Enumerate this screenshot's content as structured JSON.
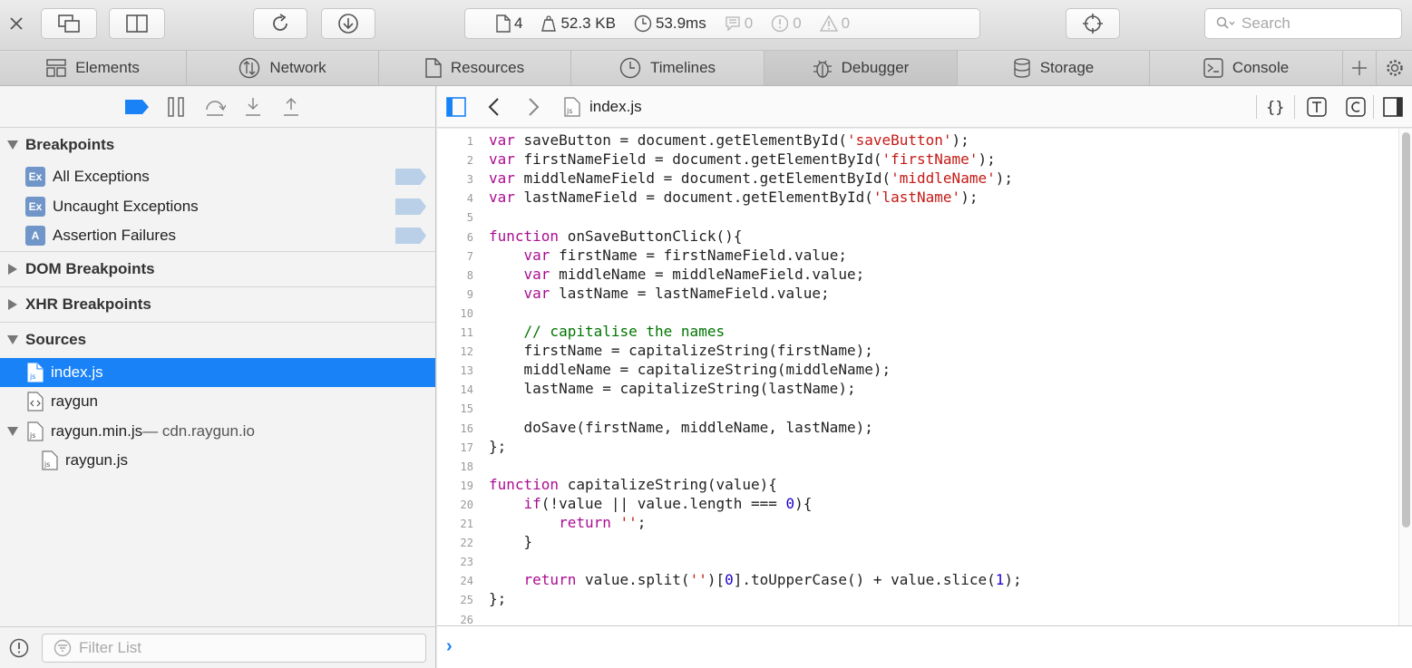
{
  "toolbar": {
    "stats": {
      "resources": "4",
      "size": "52.3 KB",
      "time": "53.9ms",
      "logs": "0",
      "errors": "0",
      "warnings": "0"
    },
    "search_placeholder": "Search",
    "icons": [
      "close-icon",
      "detach-window-icon",
      "split-panel-icon",
      "reload-icon",
      "download-icon",
      "document-icon",
      "weight-icon",
      "clock-icon",
      "log-icon",
      "error-icon",
      "warning-icon",
      "inspect-icon",
      "search-icon"
    ]
  },
  "tabs": [
    {
      "label": "Elements",
      "icon": "elements-icon"
    },
    {
      "label": "Network",
      "icon": "network-icon"
    },
    {
      "label": "Resources",
      "icon": "resources-icon"
    },
    {
      "label": "Timelines",
      "icon": "timelines-icon"
    },
    {
      "label": "Debugger",
      "icon": "debugger-icon",
      "active": true
    },
    {
      "label": "Storage",
      "icon": "storage-icon"
    },
    {
      "label": "Console",
      "icon": "console-icon"
    }
  ],
  "sidebar": {
    "breakpoints": {
      "title": "Breakpoints",
      "items": [
        {
          "badge": "Ex",
          "label": "All Exceptions"
        },
        {
          "badge": "Ex",
          "label": "Uncaught Exceptions"
        },
        {
          "badge": "A",
          "label": "Assertion Failures"
        }
      ]
    },
    "dom_breakpoints": "DOM Breakpoints",
    "xhr_breakpoints": "XHR Breakpoints",
    "sources": {
      "title": "Sources",
      "items": [
        {
          "label": "index.js",
          "selected": true
        },
        {
          "label": "raygun"
        },
        {
          "label": "raygun.min.js",
          "host": " — cdn.raygun.io"
        },
        {
          "label": "raygun.js"
        }
      ]
    },
    "filter_placeholder": "Filter List"
  },
  "editor": {
    "file_name": "index.js",
    "lines": [
      {
        "n": "1",
        "t": "var saveButton = document.getElementById('saveButton');"
      },
      {
        "n": "2",
        "t": "var firstNameField = document.getElementById('firstName');"
      },
      {
        "n": "3",
        "t": "var middleNameField = document.getElementById('middleName');"
      },
      {
        "n": "4",
        "t": "var lastNameField = document.getElementById('lastName');"
      },
      {
        "n": "5",
        "t": ""
      },
      {
        "n": "6",
        "t": "function onSaveButtonClick(){"
      },
      {
        "n": "7",
        "t": "    var firstName = firstNameField.value;"
      },
      {
        "n": "8",
        "t": "    var middleName = middleNameField.value;"
      },
      {
        "n": "9",
        "t": "    var lastName = lastNameField.value;"
      },
      {
        "n": "10",
        "t": ""
      },
      {
        "n": "11",
        "t": "    // capitalise the names"
      },
      {
        "n": "12",
        "t": "    firstName = capitalizeString(firstName);"
      },
      {
        "n": "13",
        "t": "    middleName = capitalizeString(middleName);"
      },
      {
        "n": "14",
        "t": "    lastName = capitalizeString(lastName);"
      },
      {
        "n": "15",
        "t": ""
      },
      {
        "n": "16",
        "t": "    doSave(firstName, middleName, lastName);"
      },
      {
        "n": "17",
        "t": "};"
      },
      {
        "n": "18",
        "t": ""
      },
      {
        "n": "19",
        "t": "function capitalizeString(value){"
      },
      {
        "n": "20",
        "t": "    if(!value || value.length === 0){"
      },
      {
        "n": "21",
        "t": "        return '';"
      },
      {
        "n": "22",
        "t": "    }"
      },
      {
        "n": "23",
        "t": ""
      },
      {
        "n": "24",
        "t": "    return value.split('')[0].toUpperCase() + value.slice(1);"
      },
      {
        "n": "25",
        "t": "};"
      },
      {
        "n": "26",
        "t": ""
      }
    ]
  },
  "console": {
    "prompt": "›"
  },
  "colors": {
    "accent": "#1a82f7",
    "keyword": "#aa0d91",
    "string": "#c41a16",
    "number": "#1c00cf",
    "comment": "#007400"
  }
}
